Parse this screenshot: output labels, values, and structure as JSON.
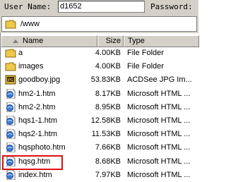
{
  "login": {
    "user_label": "User Name:",
    "user_value": "d1652",
    "password_label": "Password:"
  },
  "path": {
    "value": "/www"
  },
  "columns": {
    "name": "Name",
    "size": "Size",
    "type": "Type"
  },
  "files": [
    {
      "name": "a",
      "size": "4.00KB",
      "type": "File Folder",
      "icon": "folder-icon"
    },
    {
      "name": "images",
      "size": "4.00KB",
      "type": "File Folder",
      "icon": "folder-icon"
    },
    {
      "name": "goodboy.jpg",
      "size": "53.83KB",
      "type": "ACDSee JPG Im...",
      "icon": "image-file-icon"
    },
    {
      "name": "hm2-1.htm",
      "size": "8.17KB",
      "type": "Microsoft HTML ...",
      "icon": "html-file-icon"
    },
    {
      "name": "hm2-2.htm",
      "size": "8.95KB",
      "type": "Microsoft HTML ...",
      "icon": "html-file-icon"
    },
    {
      "name": "hqs1-1.htm",
      "size": "12.58KB",
      "type": "Microsoft HTML ...",
      "icon": "html-file-icon"
    },
    {
      "name": "hqs2-1.htm",
      "size": "11.53KB",
      "type": "Microsoft HTML ...",
      "icon": "html-file-icon"
    },
    {
      "name": "hqsphoto.htm",
      "size": "7.66KB",
      "type": "Microsoft HTML ...",
      "icon": "html-file-icon"
    },
    {
      "name": "hqsg.htm",
      "size": "8.68KB",
      "type": "Microsoft HTML ...",
      "icon": "html-file-icon"
    },
    {
      "name": "index.htm",
      "size": "7.97KB",
      "type": "Microsoft HTML ...",
      "icon": "html-file-icon"
    }
  ],
  "colors": {
    "highlight": "#e01010",
    "chrome": "#d4d0c8",
    "folder": "#f0c94a"
  }
}
